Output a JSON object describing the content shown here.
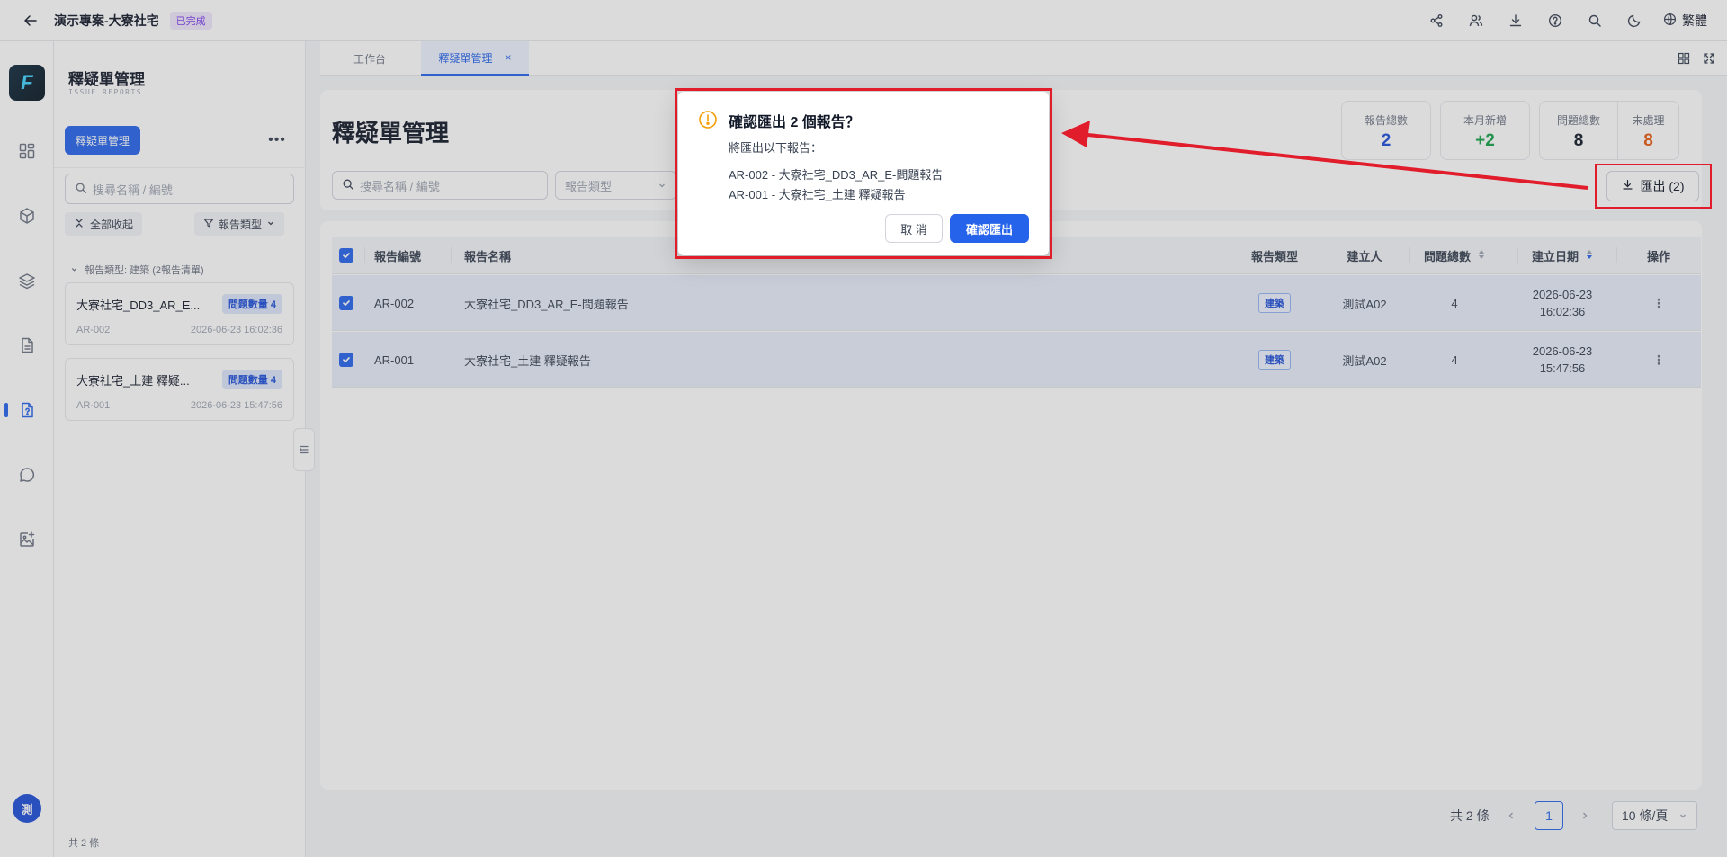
{
  "topbar": {
    "project_title": "演示專案-大寮社宅",
    "status_tag": "已完成",
    "language": "繁體",
    "icons": [
      "share-icon",
      "users-icon",
      "download-icon",
      "help-icon",
      "search-icon",
      "moon-icon",
      "globe-icon"
    ]
  },
  "rail": {
    "items": [
      "dashboard-icon",
      "cube-icon",
      "layers-icon",
      "document-icon",
      "issue-report-icon",
      "chat-icon",
      "image-plus-icon"
    ],
    "active_index": 4,
    "avatar_text": "測"
  },
  "panel": {
    "title": "釋疑單管理",
    "subtitle": "ISSUE REPORTS",
    "new_button": "釋疑單管理",
    "search_placeholder": "搜尋名稱 / 編號",
    "collapse_all": "全部收起",
    "type_filter": "報告類型",
    "group_label": "報告類型: 建築 (2報告清單)",
    "cards": [
      {
        "title": "大寮社宅_DD3_AR_E...",
        "badge": "問題數量 4",
        "id": "AR-002",
        "date": "2026-06-23 16:02:36"
      },
      {
        "title": "大寮社宅_土建 釋疑...",
        "badge": "問題數量 4",
        "id": "AR-001",
        "date": "2026-06-23 15:47:56"
      }
    ],
    "count": "共 2 條"
  },
  "tabs": [
    {
      "label": "工作台"
    },
    {
      "label": "釋疑單管理",
      "close": "×"
    }
  ],
  "main": {
    "title": "釋疑單管理",
    "search_placeholder": "搜尋名稱 / 編號",
    "type_placeholder": "報告類型",
    "export_button": "匯出 (2)"
  },
  "stats": {
    "total_reports": {
      "label": "報告總數",
      "value": "2",
      "color": "#1d4ed8"
    },
    "new_this_month": {
      "label": "本月新增",
      "value": "+2",
      "color": "#16a34a"
    },
    "total_issues": {
      "label": "問題總數",
      "value": "8",
      "color": "#111827"
    },
    "unprocessed": {
      "label": "未處理",
      "value": "8",
      "color": "#ea580c"
    }
  },
  "table": {
    "columns": [
      "報告編號",
      "報告名稱",
      "報告類型",
      "建立人",
      "問題總數",
      "建立日期",
      "操作"
    ],
    "rows": [
      {
        "id": "AR-002",
        "name": "大寮社宅_DD3_AR_E-問題報告",
        "type": "建築",
        "creator": "測試A02",
        "issues": "4",
        "date": "2026-06-23",
        "time": "16:02:36",
        "selected": true
      },
      {
        "id": "AR-001",
        "name": "大寮社宅_土建 釋疑報告",
        "type": "建築",
        "creator": "測試A02",
        "issues": "4",
        "date": "2026-06-23",
        "time": "15:47:56",
        "selected": true
      }
    ]
  },
  "pagination": {
    "total": "共 2 條",
    "current_page": "1",
    "page_size": "10 條/頁"
  },
  "modal": {
    "title": "確認匯出 2 個報告？",
    "subtitle": "將匯出以下報告：",
    "lines": [
      "AR-002 - 大寮社宅_DD3_AR_E-問題報告",
      "AR-001 - 大寮社宅_土建 釋疑報告"
    ],
    "cancel": "取 消",
    "confirm": "確認匯出"
  },
  "annotation": {
    "color": "#e11d2b"
  }
}
